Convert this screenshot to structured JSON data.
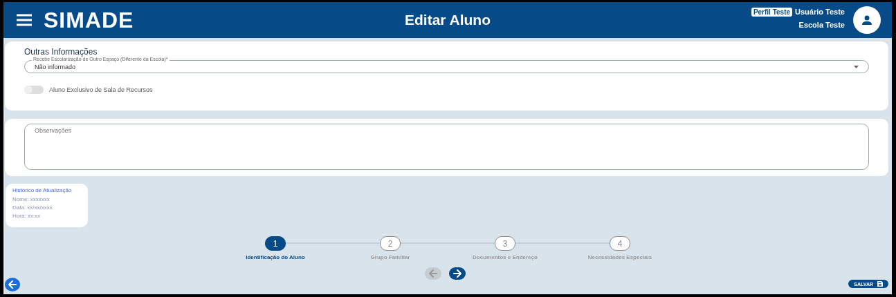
{
  "header": {
    "brand": "SIMADE",
    "title": "Editar Aluno",
    "profile_badge": "Perfil Teste",
    "user_name": "Usuário Teste",
    "school": "Escola Teste"
  },
  "other_info": {
    "heading": "Outras Informações",
    "select": {
      "label": "Recebe Escolarização de Outro Espaço (Diferente da Escola)*",
      "value": "Não informado"
    },
    "toggle": {
      "label": "Aluno Exclusivo de Sala de Recursos",
      "on": false
    }
  },
  "observations": {
    "placeholder": "Observações"
  },
  "history": {
    "title": "Histórico de Atualização",
    "lines": [
      "Nome: xxxxxxx",
      "Data: xx/xx/xxxx",
      "Hora: xx:xx"
    ]
  },
  "steps": [
    {
      "number": "1",
      "label": "Identificação do Aluno",
      "selected": true
    },
    {
      "number": "2",
      "label": "Grupo Familiar",
      "selected": false
    },
    {
      "number": "3",
      "label": "Documentos e Endereço",
      "selected": false
    },
    {
      "number": "4",
      "label": "Necessidades Especiais",
      "selected": false
    }
  ],
  "nav": {
    "previous_disabled": true,
    "next_disabled": false
  },
  "save_button": "SALVAR"
}
